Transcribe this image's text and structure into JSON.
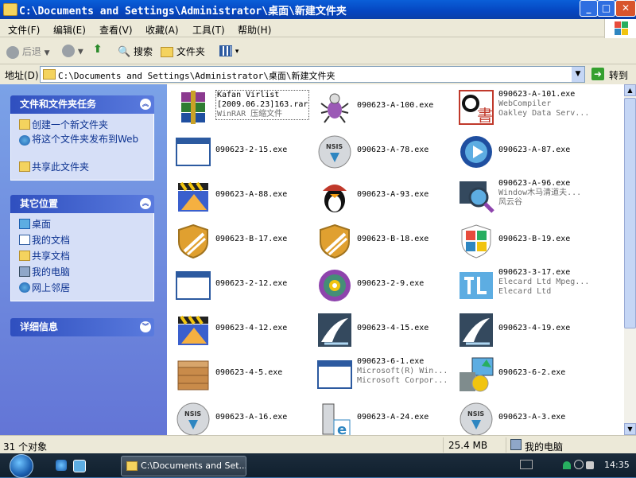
{
  "window": {
    "title": "C:\\Documents and Settings\\Administrator\\桌面\\新建文件夹",
    "buttons": {
      "minimize": "_",
      "maximize": "□",
      "close": "✕"
    }
  },
  "menu": [
    "文件(F)",
    "编辑(E)",
    "查看(V)",
    "收藏(A)",
    "工具(T)",
    "帮助(H)"
  ],
  "toolbar": {
    "back": "后退",
    "search": "搜索",
    "folders": "文件夹"
  },
  "address": {
    "label": "地址(D)",
    "path": "C:\\Documents and Settings\\Administrator\\桌面\\新建文件夹",
    "go": "转到"
  },
  "tasks": {
    "file_tasks": {
      "title": "文件和文件夹任务",
      "items": [
        "创建一个新文件夹",
        "将这个文件夹发布到Web",
        "共享此文件夹"
      ]
    },
    "other_places": {
      "title": "其它位置",
      "items": [
        "桌面",
        "我的文档",
        "共享文档",
        "我的电脑",
        "网上邻居"
      ]
    },
    "details": {
      "title": "详细信息"
    }
  },
  "files": [
    {
      "name": "Kafan Virlist",
      "l2": "[2009.06.23]163.rar",
      "l3": "WinRAR 压缩文件",
      "icon": "winrar",
      "color": "#8b3a8f"
    },
    {
      "name": "090623-A-100.exe",
      "icon": "bug",
      "color": "#9b59b6"
    },
    {
      "name": "090623-A-101.exe",
      "l2": "WebCompiler",
      "l3": "Oakley Data Serv...",
      "icon": "book",
      "color": "#c0392b"
    },
    {
      "name": "090623-2-15.exe",
      "icon": "window",
      "color": "#2c5aa0"
    },
    {
      "name": "090623-A-78.exe",
      "icon": "nsis",
      "color": "#2e86c1"
    },
    {
      "name": "090623-A-87.exe",
      "icon": "media",
      "color": "#1f4fa0"
    },
    {
      "name": "090623-A-88.exe",
      "icon": "clapper",
      "color": "#f1c40f"
    },
    {
      "name": "090623-A-93.exe",
      "icon": "penguin",
      "color": "#c0392b"
    },
    {
      "name": "090623-A-96.exe",
      "l2": "Window木马清道夫...",
      "l3": "风云谷",
      "icon": "magnifier",
      "color": "#34495e"
    },
    {
      "name": "090623-B-17.exe",
      "icon": "shield",
      "color": "#e0a030"
    },
    {
      "name": "090623-B-18.exe",
      "icon": "shield",
      "color": "#e0a030"
    },
    {
      "name": "090623-B-19.exe",
      "icon": "winshield",
      "color": "#2e86c1"
    },
    {
      "name": "090623-2-12.exe",
      "icon": "window",
      "color": "#2c5aa0"
    },
    {
      "name": "090623-2-9.exe",
      "icon": "cd",
      "color": "#8e44ad"
    },
    {
      "name": "090623-3-17.exe",
      "l2": "Elecard Ltd Mpeg...",
      "l3": "Elecard Ltd",
      "icon": "elecard",
      "color": "#5dade2"
    },
    {
      "name": "090623-4-12.exe",
      "icon": "clapper",
      "color": "#f1c40f"
    },
    {
      "name": "090623-4-15.exe",
      "icon": "swoosh",
      "color": "#34495e"
    },
    {
      "name": "090623-4-19.exe",
      "icon": "swoosh",
      "color": "#34495e"
    },
    {
      "name": "090623-4-5.exe",
      "icon": "box",
      "color": "#c98b4a"
    },
    {
      "name": "090623-6-1.exe",
      "l2": "Microsoft(R) Win...",
      "l3": "Microsoft Corpor...",
      "icon": "window",
      "color": "#2c5aa0"
    },
    {
      "name": "090623-6-2.exe",
      "icon": "installer",
      "color": "#27ae60"
    },
    {
      "name": "090623-A-16.exe",
      "icon": "nsis",
      "color": "#2e86c1"
    },
    {
      "name": "090623-A-24.exe",
      "icon": "ie",
      "color": "#2e86c1"
    },
    {
      "name": "090623-A-3.exe",
      "icon": "nsis",
      "color": "#2e86c1"
    }
  ],
  "status": {
    "count": "31 个对象",
    "size": "25.4 MB",
    "location": "我的电脑"
  },
  "taskbar": {
    "task": "C:\\Documents and Set...",
    "clock": "14:35"
  }
}
